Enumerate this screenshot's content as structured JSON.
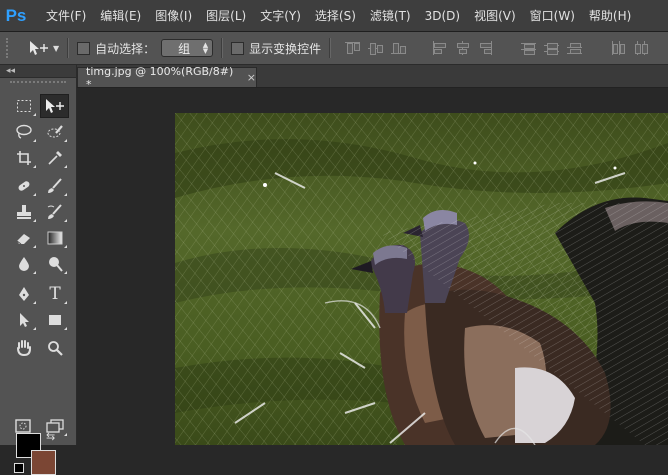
{
  "app": {
    "logo": "Ps"
  },
  "menu": [
    "文件(F)",
    "编辑(E)",
    "图像(I)",
    "图层(L)",
    "文字(Y)",
    "选择(S)",
    "滤镜(T)",
    "3D(D)",
    "视图(V)",
    "窗口(W)",
    "帮助(H)"
  ],
  "options": {
    "auto_select_label": "自动选择：",
    "auto_select_value": "组",
    "show_transform_label": "显示变换控件"
  },
  "toolbox": {
    "collapse_label": "◂◂",
    "tools": [
      "move-tool-icon",
      "marquee-tool-icon",
      "lasso-tool-icon",
      "quick-select-tool-icon",
      "crop-tool-icon",
      "eyedropper-tool-icon",
      "healing-brush-icon",
      "brush-tool-icon",
      "stamp-tool-icon",
      "history-brush-icon",
      "eraser-tool-icon",
      "gradient-tool-icon",
      "blur-tool-icon",
      "dodge-tool-icon",
      "pen-tool-icon",
      "type-tool-icon",
      "path-select-tool-icon",
      "shape-tool-icon",
      "hand-tool-icon",
      "zoom-tool-icon",
      "quick-mask-icon",
      "screen-mode-icon"
    ],
    "colors": {
      "foreground": "#000000",
      "background": "#7b4634"
    }
  },
  "document": {
    "tab_title": "timg.jpg @ 100%(RGB/8#) *",
    "close_glyph": "×"
  }
}
